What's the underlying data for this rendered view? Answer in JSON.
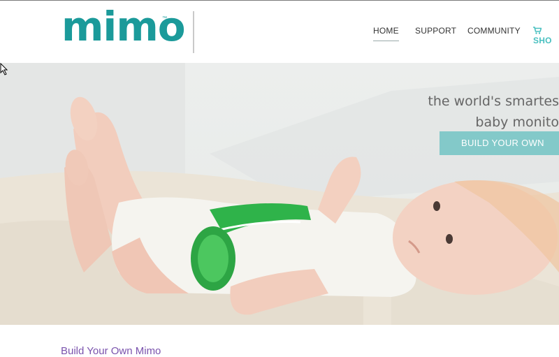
{
  "brand": {
    "logo_text": "mimo",
    "logo_mark": "™",
    "accent": "#1b9a9a"
  },
  "nav": {
    "items": [
      {
        "label": "HOME",
        "active": true
      },
      {
        "label": "SUPPORT",
        "active": false
      },
      {
        "label": "COMMUNITY",
        "active": false
      }
    ],
    "shop_label": "SHO",
    "shop_color": "#49c0c0"
  },
  "hero": {
    "line1": "the world's smartes",
    "line2": "baby monito",
    "cta_label": "BUILD YOUR OWN",
    "cta_color": "#83c9c9"
  },
  "section": {
    "title": "Build Your Own Mimo"
  }
}
